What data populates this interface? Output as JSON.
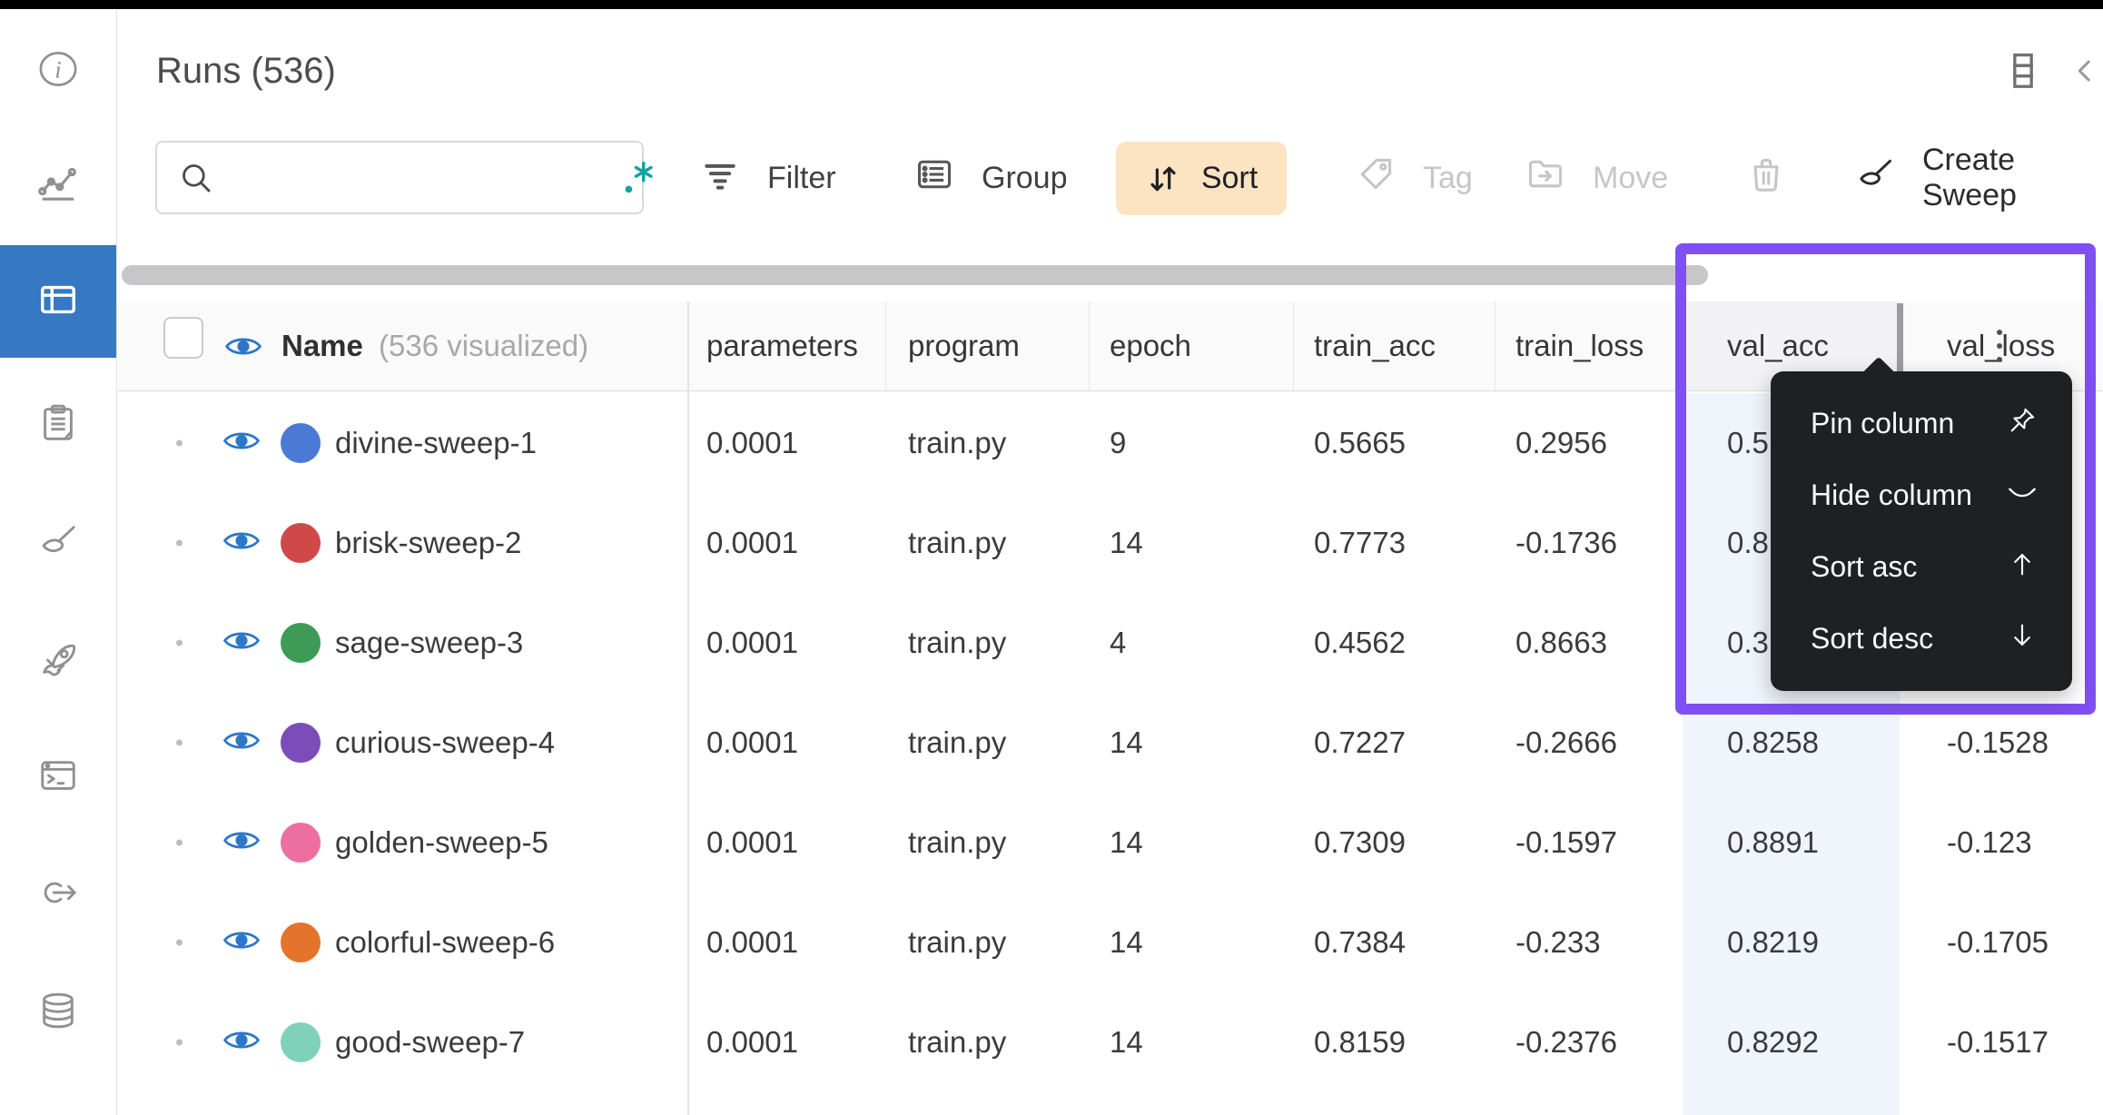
{
  "header": {
    "title": "Runs (536)"
  },
  "header_icons": {
    "columns_panel": "stacked-rows-icon",
    "collapse": "chevron-left-icon"
  },
  "sidebar": {
    "active_index": 2,
    "items": [
      {
        "id": "info",
        "icon": "info-icon"
      },
      {
        "id": "workspace",
        "icon": "line-chart-icon"
      },
      {
        "id": "runs-table",
        "icon": "table-icon"
      },
      {
        "id": "logs",
        "icon": "clipboard-icon"
      },
      {
        "id": "sweeps",
        "icon": "broom-icon"
      },
      {
        "id": "launch",
        "icon": "rocket-icon"
      },
      {
        "id": "terminal",
        "icon": "terminal-icon"
      },
      {
        "id": "automations",
        "icon": "circle-arrow-icon"
      },
      {
        "id": "artifacts",
        "icon": "database-icon"
      }
    ]
  },
  "toolbar": {
    "search": {
      "value": "",
      "placeholder": "",
      "left_icon": "magnifier-icon",
      "right_icon": "regex-dot-asterisk-icon"
    },
    "filter_label": "Filter",
    "group_label": "Group",
    "sort_label": "Sort",
    "tag_label": "Tag",
    "move_label": "Move",
    "delete_icon": "trash-icon",
    "create_sweep_label": "Create Sweep",
    "sort_active": true,
    "disabled_buttons": [
      "Tag",
      "Move",
      "trash"
    ]
  },
  "table": {
    "name_header": {
      "label": "Name",
      "sub": "(536 visualized)",
      "eye_icon": "eye-icon",
      "checkbox_checked": false
    },
    "columns": [
      "parameters",
      "program",
      "epoch",
      "train_acc",
      "train_loss",
      "val_acc",
      "val_loss"
    ],
    "rows": [
      {
        "name": "divine-sweep-1",
        "color": "#4B7AD4",
        "parameters": "0.0001",
        "program": "train.py",
        "epoch": "9",
        "train_acc": "0.5665",
        "train_loss": "0.2956",
        "val_acc": "0.5",
        "val_loss": ""
      },
      {
        "name": "brisk-sweep-2",
        "color": "#D04949",
        "parameters": "0.0001",
        "program": "train.py",
        "epoch": "14",
        "train_acc": "0.7773",
        "train_loss": "-0.1736",
        "val_acc": "0.8",
        "val_loss": ""
      },
      {
        "name": "sage-sweep-3",
        "color": "#3E9B57",
        "parameters": "0.0001",
        "program": "train.py",
        "epoch": "4",
        "train_acc": "0.4562",
        "train_loss": "0.8663",
        "val_acc": "0.3",
        "val_loss": ""
      },
      {
        "name": "curious-sweep-4",
        "color": "#7C4CB8",
        "parameters": "0.0001",
        "program": "train.py",
        "epoch": "14",
        "train_acc": "0.7227",
        "train_loss": "-0.2666",
        "val_acc": "0.8258",
        "val_loss": "-0.1528"
      },
      {
        "name": "golden-sweep-5",
        "color": "#EC6F9F",
        "parameters": "0.0001",
        "program": "train.py",
        "epoch": "14",
        "train_acc": "0.7309",
        "train_loss": "-0.1597",
        "val_acc": "0.8891",
        "val_loss": "-0.123"
      },
      {
        "name": "colorful-sweep-6",
        "color": "#E4732C",
        "parameters": "0.0001",
        "program": "train.py",
        "epoch": "14",
        "train_acc": "0.7384",
        "train_loss": "-0.233",
        "val_acc": "0.8219",
        "val_loss": "-0.1705"
      },
      {
        "name": "good-sweep-7",
        "color": "#7FD2B8",
        "parameters": "0.0001",
        "program": "train.py",
        "epoch": "14",
        "train_acc": "0.8159",
        "train_loss": "-0.2376",
        "val_acc": "0.8292",
        "val_loss": "-0.1517"
      }
    ]
  },
  "column_menu": {
    "target_column": "val_acc",
    "items": [
      {
        "label": "Pin column",
        "icon": "pin-icon"
      },
      {
        "label": "Hide column",
        "icon": "eye-closed-icon"
      },
      {
        "label": "Sort asc",
        "icon": "arrow-up-icon"
      },
      {
        "label": "Sort desc",
        "icon": "arrow-down-icon"
      }
    ]
  },
  "colors": {
    "sidebar_active_blue": "#3778C2",
    "eye_blue": "#2C77C9",
    "sort_button_bg": "#FCE3C2",
    "highlight_purple": "#7E4FF2",
    "val_acc_column_tint": "#EFF5FA",
    "menu_bg": "#1F2023",
    "regex_teal": "#0FA3A3"
  }
}
